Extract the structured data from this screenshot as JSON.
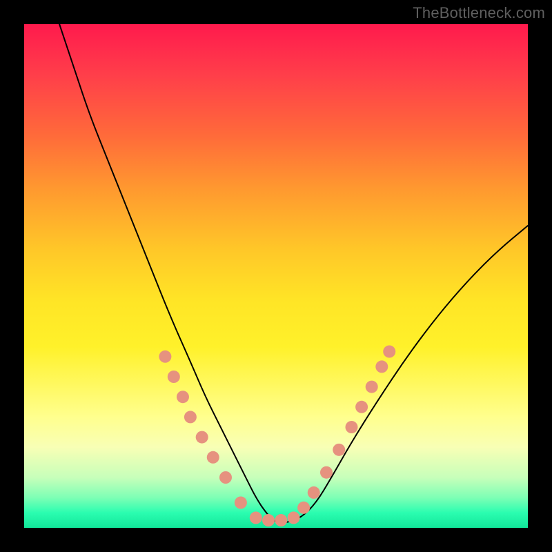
{
  "watermark": "TheBottleneck.com",
  "chart_data": {
    "type": "line",
    "title": "",
    "xlabel": "",
    "ylabel": "",
    "xlim": [
      0,
      100
    ],
    "ylim": [
      0,
      100
    ],
    "grid": false,
    "legend": false,
    "series": [
      {
        "name": "bottleneck-curve",
        "color": "#000000",
        "x": [
          7,
          10,
          13,
          17,
          21,
          25,
          29,
          33,
          36,
          39,
          42,
          44,
          46,
          48,
          50,
          52,
          55,
          58,
          61,
          65,
          70,
          76,
          82,
          88,
          94,
          100
        ],
        "y": [
          100,
          91,
          82,
          72,
          62,
          52,
          42,
          33,
          26,
          20,
          14,
          10,
          6,
          3,
          1,
          1,
          2,
          5,
          10,
          17,
          25,
          34,
          42,
          49,
          55,
          60
        ]
      }
    ],
    "markers": [
      {
        "name": "marker",
        "color": "#e6927f",
        "x": 28.0,
        "y": 34.0
      },
      {
        "name": "marker",
        "color": "#e6927f",
        "x": 29.7,
        "y": 30.0
      },
      {
        "name": "marker",
        "color": "#e6927f",
        "x": 31.5,
        "y": 26.0
      },
      {
        "name": "marker",
        "color": "#e6927f",
        "x": 33.0,
        "y": 22.0
      },
      {
        "name": "marker",
        "color": "#e6927f",
        "x": 35.3,
        "y": 18.0
      },
      {
        "name": "marker",
        "color": "#e6927f",
        "x": 37.5,
        "y": 14.0
      },
      {
        "name": "marker",
        "color": "#e6927f",
        "x": 40.0,
        "y": 10.0
      },
      {
        "name": "marker",
        "color": "#e6927f",
        "x": 43.0,
        "y": 5.0
      },
      {
        "name": "marker",
        "color": "#e6927f",
        "x": 46.0,
        "y": 2.0
      },
      {
        "name": "marker",
        "color": "#e6927f",
        "x": 48.5,
        "y": 1.5
      },
      {
        "name": "marker",
        "color": "#e6927f",
        "x": 51.0,
        "y": 1.5
      },
      {
        "name": "marker",
        "color": "#e6927f",
        "x": 53.5,
        "y": 2.0
      },
      {
        "name": "marker",
        "color": "#e6927f",
        "x": 55.5,
        "y": 4.0
      },
      {
        "name": "marker",
        "color": "#e6927f",
        "x": 57.5,
        "y": 7.0
      },
      {
        "name": "marker",
        "color": "#e6927f",
        "x": 60.0,
        "y": 11.0
      },
      {
        "name": "marker",
        "color": "#e6927f",
        "x": 62.5,
        "y": 15.5
      },
      {
        "name": "marker",
        "color": "#e6927f",
        "x": 65.0,
        "y": 20.0
      },
      {
        "name": "marker",
        "color": "#e6927f",
        "x": 67.0,
        "y": 24.0
      },
      {
        "name": "marker",
        "color": "#e6927f",
        "x": 69.0,
        "y": 28.0
      },
      {
        "name": "marker",
        "color": "#e6927f",
        "x": 71.0,
        "y": 32.0
      },
      {
        "name": "marker",
        "color": "#e6927f",
        "x": 72.5,
        "y": 35.0
      }
    ],
    "colors": {
      "gradient_top": "#ff1a4d",
      "gradient_bottom": "#11e79a",
      "curve": "#000000",
      "marker": "#e6927f",
      "frame": "#000000"
    }
  }
}
